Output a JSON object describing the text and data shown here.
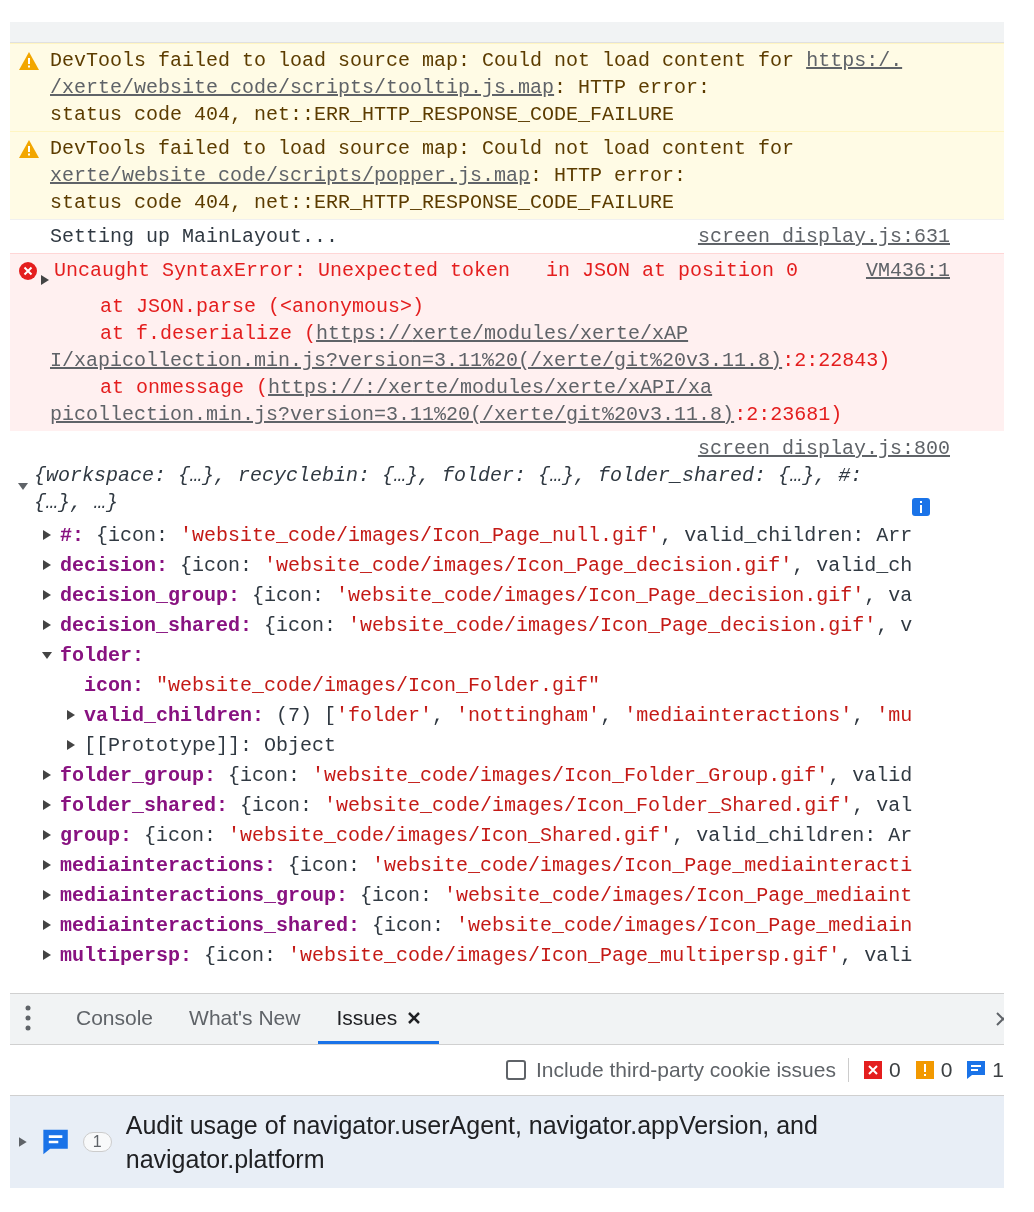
{
  "messages": [
    {
      "kind": "warning",
      "lines": [
        [
          {
            "kind": "text",
            "text": "DevTools failed to load source map: Could not load content for "
          },
          {
            "kind": "link",
            "text": "https:/."
          }
        ],
        [
          {
            "kind": "link",
            "text": "/xerte/website_code/scripts/tooltip.js.map"
          },
          {
            "kind": "text",
            "text": ": HTTP error:"
          }
        ],
        [
          {
            "kind": "text",
            "text": "status code 404, net::ERR_HTTP_RESPONSE_CODE_FAILURE"
          }
        ]
      ]
    },
    {
      "kind": "warning",
      "lines": [
        [
          {
            "kind": "text",
            "text": "DevTools failed to load source map: Could not load content for "
          }
        ],
        [
          {
            "kind": "link",
            "text": "xerte/website_code/scripts/popper.js.map"
          },
          {
            "kind": "text",
            "text": ": HTTP error:"
          }
        ],
        [
          {
            "kind": "text",
            "text": "status code 404, net::ERR_HTTP_RESPONSE_CODE_FAILURE"
          }
        ]
      ]
    },
    {
      "kind": "log",
      "source": "screen_display.js:631",
      "lines": [
        [
          {
            "kind": "text",
            "text": "Setting up MainLayout..."
          }
        ]
      ]
    },
    {
      "kind": "error",
      "source": "VM436:1",
      "expanded": false,
      "lines": [
        [
          {
            "kind": "text",
            "text": "Uncaught SyntaxError: Unexpected token   in JSON at position 0"
          }
        ],
        [
          {
            "kind": "stack",
            "text": "at JSON.parse (<anonymous>)"
          }
        ],
        [
          {
            "kind": "stack",
            "text": "at f.deserialize ("
          },
          {
            "kind": "link",
            "text": "https://"
          },
          {
            "kind": "link",
            "text": "xerte/modules/xerte/xAP"
          }
        ],
        [
          {
            "kind": "link",
            "text": "I/xapicollection.min.js?version=3.11%20(/xerte/git%20v3.11.8)"
          },
          {
            "kind": "text",
            "text": ":2:22843)"
          }
        ],
        [
          {
            "kind": "stack",
            "text": "at onmessage ("
          },
          {
            "kind": "link",
            "text": "https://"
          },
          {
            "kind": "link",
            "text": ":/xerte/modules/xerte/xAPI/xa"
          }
        ],
        [
          {
            "kind": "link",
            "text": "picollection.min.js?version=3.11%20(/xerte/git%20v3.11.8)"
          },
          {
            "kind": "text",
            "text": ":2:23681)"
          }
        ]
      ]
    },
    {
      "kind": "object",
      "source": "screen_display.js:800",
      "expanded": true,
      "summary": "{workspace: {…}, recyclebin: {…}, folder: {…}, folder_shared: {…}, #: {…}, …}",
      "entries": [
        {
          "kind": "expandable",
          "expanded": false,
          "key": "#:",
          "value": [
            {
              "kind": "plain",
              "text": "{icon: "
            },
            {
              "kind": "string",
              "text": "'website_code/images/Icon_Page_null.gif'"
            },
            {
              "kind": "plain",
              "text": ", valid_children: Arr"
            }
          ]
        },
        {
          "kind": "expandable",
          "expanded": false,
          "key": "decision:",
          "value": [
            {
              "kind": "plain",
              "text": "{icon: "
            },
            {
              "kind": "string",
              "text": "'website_code/images/Icon_Page_decision.gif'"
            },
            {
              "kind": "plain",
              "text": ", valid_ch"
            }
          ]
        },
        {
          "kind": "expandable",
          "expanded": false,
          "key": "decision_group:",
          "value": [
            {
              "kind": "plain",
              "text": "{icon: "
            },
            {
              "kind": "string",
              "text": "'website_code/images/Icon_Page_decision.gif'"
            },
            {
              "kind": "plain",
              "text": ", va"
            }
          ]
        },
        {
          "kind": "expandable",
          "expanded": false,
          "key": "decision_shared:",
          "value": [
            {
              "kind": "plain",
              "text": "{icon: "
            },
            {
              "kind": "string",
              "text": "'website_code/images/Icon_Page_decision.gif'"
            },
            {
              "kind": "plain",
              "text": ", v"
            }
          ]
        },
        {
          "kind": "expandable",
          "expanded": true,
          "key": "folder:",
          "children": [
            {
              "kind": "leaf",
              "key": "icon:",
              "value": [
                {
                  "kind": "string",
                  "text": "\"website_code/images/Icon_Folder.gif\""
                }
              ]
            },
            {
              "kind": "expandable",
              "expanded": false,
              "key": "valid_children:",
              "value": [
                {
                  "kind": "plain",
                  "text": "(7) ["
                },
                {
                  "kind": "string",
                  "text": "'folder'"
                },
                {
                  "kind": "plain",
                  "text": ", "
                },
                {
                  "kind": "string",
                  "text": "'nottingham'"
                },
                {
                  "kind": "plain",
                  "text": ", "
                },
                {
                  "kind": "string",
                  "text": "'mediainteractions'"
                },
                {
                  "kind": "plain",
                  "text": ", "
                },
                {
                  "kind": "string",
                  "text": "'mu"
                }
              ]
            },
            {
              "kind": "expandable",
              "expanded": false,
              "key": "[[Prototype]]:",
              "internal": true,
              "value": [
                {
                  "kind": "plain",
                  "text": "Object"
                }
              ]
            }
          ]
        },
        {
          "kind": "expandable",
          "expanded": false,
          "key": "folder_group:",
          "value": [
            {
              "kind": "plain",
              "text": "{icon: "
            },
            {
              "kind": "string",
              "text": "'website_code/images/Icon_Folder_Group.gif'"
            },
            {
              "kind": "plain",
              "text": ", valid"
            }
          ]
        },
        {
          "kind": "expandable",
          "expanded": false,
          "key": "folder_shared:",
          "value": [
            {
              "kind": "plain",
              "text": "{icon: "
            },
            {
              "kind": "string",
              "text": "'website_code/images/Icon_Folder_Shared.gif'"
            },
            {
              "kind": "plain",
              "text": ", val"
            }
          ]
        },
        {
          "kind": "expandable",
          "expanded": false,
          "key": "group:",
          "value": [
            {
              "kind": "plain",
              "text": "{icon: "
            },
            {
              "kind": "string",
              "text": "'website_code/images/Icon_Shared.gif'"
            },
            {
              "kind": "plain",
              "text": ", valid_children: Ar"
            }
          ]
        },
        {
          "kind": "expandable",
          "expanded": false,
          "key": "mediainteractions:",
          "value": [
            {
              "kind": "plain",
              "text": "{icon: "
            },
            {
              "kind": "string",
              "text": "'website_code/images/Icon_Page_mediainteracti"
            }
          ]
        },
        {
          "kind": "expandable",
          "expanded": false,
          "key": "mediainteractions_group:",
          "value": [
            {
              "kind": "plain",
              "text": "{icon: "
            },
            {
              "kind": "string",
              "text": "'website_code/images/Icon_Page_mediaint"
            }
          ]
        },
        {
          "kind": "expandable",
          "expanded": false,
          "key": "mediainteractions_shared:",
          "value": [
            {
              "kind": "plain",
              "text": "{icon: "
            },
            {
              "kind": "string",
              "text": "'website_code/images/Icon_Page_mediain"
            }
          ]
        },
        {
          "kind": "expandable",
          "expanded": false,
          "key": "multipersp:",
          "value": [
            {
              "kind": "plain",
              "text": "{icon: "
            },
            {
              "kind": "string",
              "text": "'website_code/images/Icon_Page_multipersp.gif'"
            },
            {
              "kind": "plain",
              "text": ", vali"
            }
          ]
        }
      ]
    }
  ],
  "drawer": {
    "tabs": [
      {
        "label": "Console",
        "selected": false,
        "closable": false
      },
      {
        "label": "What's New",
        "selected": false,
        "closable": false
      },
      {
        "label": "Issues",
        "selected": true,
        "closable": true
      }
    ],
    "toolbar": {
      "checkbox": {
        "label": "Include third-party cookie issues",
        "checked": false
      },
      "counts": [
        {
          "kind": "error",
          "count": "0"
        },
        {
          "kind": "warning",
          "count": "0"
        },
        {
          "kind": "info",
          "count": "1"
        }
      ]
    },
    "issues": [
      {
        "expanded": false,
        "count": "1",
        "text": "Audit usage of navigator.userAgent, navigator.appVersion, and navigator.platform"
      }
    ]
  }
}
